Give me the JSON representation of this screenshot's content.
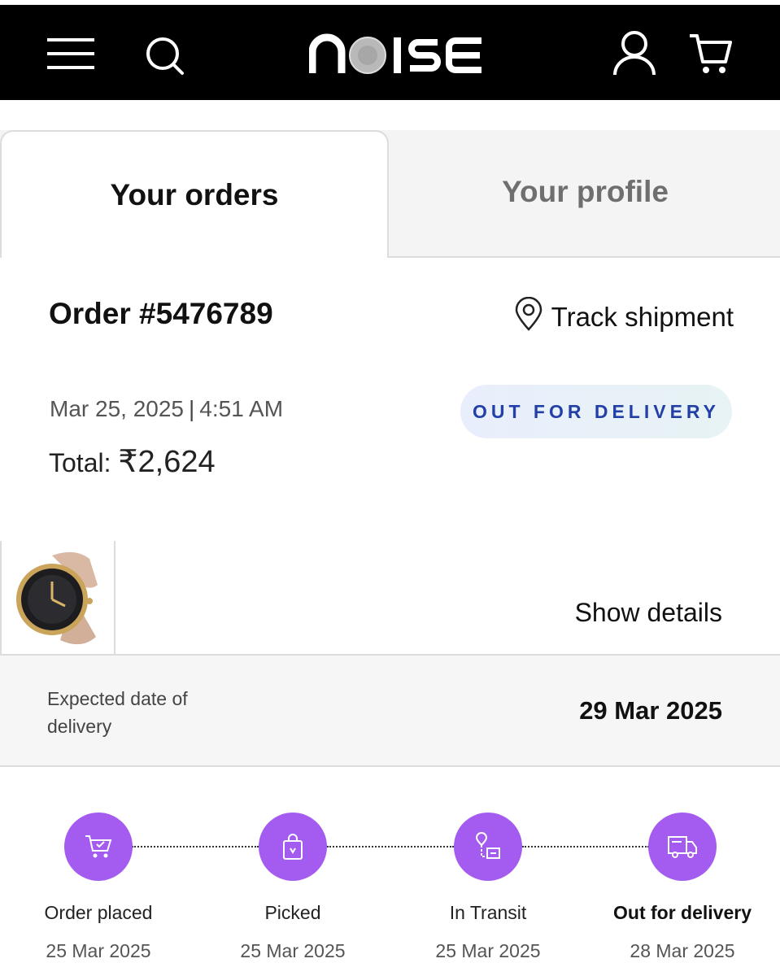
{
  "header": {
    "brand": "NOISE",
    "menu_icon": "hamburger-icon",
    "search_icon": "search-icon",
    "account_icon": "user-icon",
    "cart_icon": "cart-icon"
  },
  "tabs": [
    {
      "label": "Your orders",
      "active": true
    },
    {
      "label": "Your profile",
      "active": false
    }
  ],
  "order": {
    "number": "Order #5476789",
    "track_label": "Track shipment",
    "date": "Mar 25, 2025",
    "separator": "|",
    "time": "4:51 AM",
    "total_label": "Total:",
    "total_value": "₹2,624",
    "status": "OUT FOR DELIVERY",
    "show_details": "Show details",
    "product_image": "smartwatch-rose-gold"
  },
  "delivery": {
    "expected_label": "Expected date of delivery",
    "expected_date": "29 Mar 2025"
  },
  "timeline": [
    {
      "label": "Order placed",
      "date": "25 Mar 2025",
      "icon": "cart-check-icon"
    },
    {
      "label": "Picked",
      "date": "25 Mar 2025",
      "icon": "shopping-bag-icon"
    },
    {
      "label": "In Transit",
      "date": "25 Mar 2025",
      "icon": "transit-location-icon"
    },
    {
      "label": "Out for delivery",
      "date": "28 Mar 2025",
      "icon": "delivery-truck-icon"
    }
  ],
  "colors": {
    "header_bg": "#000000",
    "step_accent": "#a35bf0",
    "status_text": "#233fa8"
  }
}
